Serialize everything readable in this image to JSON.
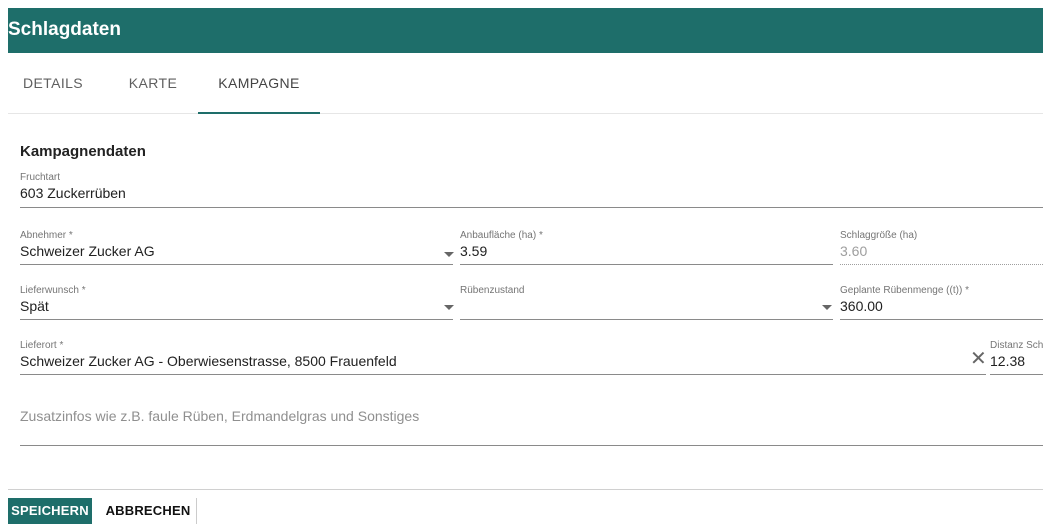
{
  "header": {
    "title": "Schlagdaten"
  },
  "tabs": [
    {
      "label": "DETAILS"
    },
    {
      "label": "KARTE"
    },
    {
      "label": "KAMPAGNE",
      "active": true
    }
  ],
  "section": {
    "title": "Kampagnendaten"
  },
  "fields": {
    "fruchtart": {
      "label": "Fruchtart",
      "value": "603 Zuckerrüben"
    },
    "abnehmer": {
      "label": "Abnehmer *",
      "value": "Schweizer Zucker AG"
    },
    "anbauflaeche": {
      "label": "Anbaufläche (ha) *",
      "value": "3.59"
    },
    "schlaggroesse": {
      "label": "Schlaggröße (ha)",
      "value": "3.60"
    },
    "lieferwunsch": {
      "label": "Lieferwunsch *",
      "value": "Spät"
    },
    "ruebenzustand": {
      "label": "Rübenzustand",
      "value": ""
    },
    "geplante_menge": {
      "label": "Geplante Rübenmenge ((t)) *",
      "value": "360.00"
    },
    "lieferort": {
      "label": "Lieferort *",
      "value": "Schweizer Zucker AG - Oberwiesenstrasse, 8500 Frauenfeld"
    },
    "distanz": {
      "label": "Distanz Sch",
      "value": "12.38"
    }
  },
  "zusatzinfos": {
    "placeholder": "Zusatzinfos wie z.B. faule Rüben, Erdmandelgras und Sonstiges"
  },
  "buttons": {
    "save": "SPEICHERN",
    "cancel": "ABBRECHEN"
  },
  "colors": {
    "primary": "#1e6e6a"
  }
}
